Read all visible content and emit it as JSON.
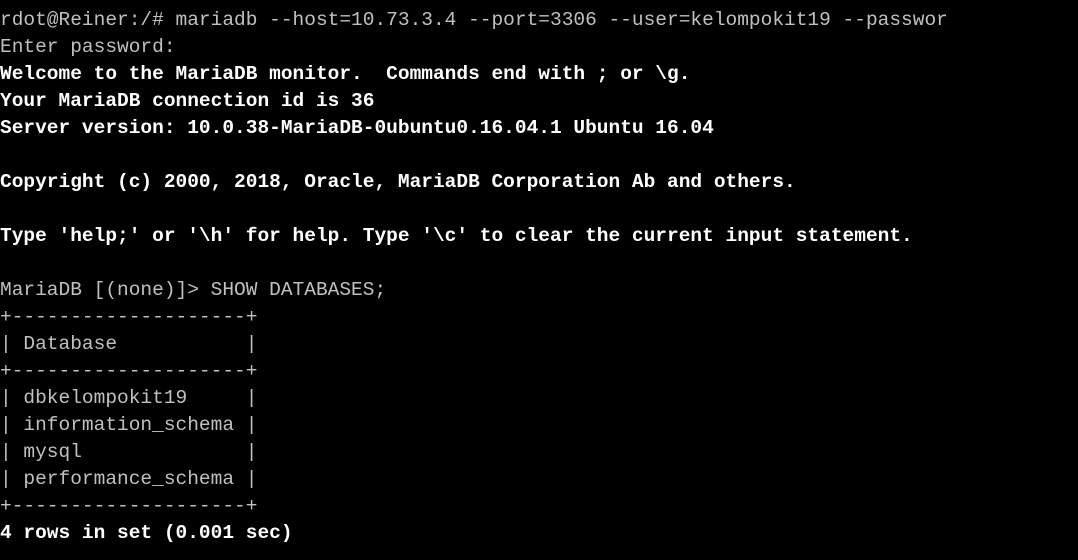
{
  "terminal": {
    "colors": {
      "background": "#000000",
      "normal_text": "#c0c0c0",
      "bright_text": "#ffffff"
    },
    "lines": [
      {
        "text": "rdot@Reiner:/# mariadb --host=10.73.3.4 --port=3306 --user=kelompokit19 --passwor",
        "bold": false
      },
      {
        "text": "Enter password:",
        "bold": false
      },
      {
        "text": "Welcome to the MariaDB monitor.  Commands end with ; or \\g.",
        "bold": true
      },
      {
        "text": "Your MariaDB connection id is 36",
        "bold": true
      },
      {
        "text": "Server version: 10.0.38-MariaDB-0ubuntu0.16.04.1 Ubuntu 16.04",
        "bold": true
      },
      {
        "text": "",
        "bold": false
      },
      {
        "text": "Copyright (c) 2000, 2018, Oracle, MariaDB Corporation Ab and others.",
        "bold": true
      },
      {
        "text": "",
        "bold": false
      },
      {
        "text": "Type 'help;' or '\\h' for help. Type '\\c' to clear the current input statement.",
        "bold": true
      },
      {
        "text": "",
        "bold": false
      },
      {
        "text": "MariaDB [(none)]> SHOW DATABASES;",
        "bold": false
      },
      {
        "text": "+--------------------+",
        "bold": false
      },
      {
        "text": "| Database           |",
        "bold": false
      },
      {
        "text": "+--------------------+",
        "bold": false
      },
      {
        "text": "| dbkelompokit19     |",
        "bold": false
      },
      {
        "text": "| information_schema |",
        "bold": false
      },
      {
        "text": "| mysql              |",
        "bold": false
      },
      {
        "text": "| performance_schema |",
        "bold": false
      },
      {
        "text": "+--------------------+",
        "bold": false
      },
      {
        "text": "4 rows in set (0.001 sec)",
        "bold": true
      }
    ]
  }
}
